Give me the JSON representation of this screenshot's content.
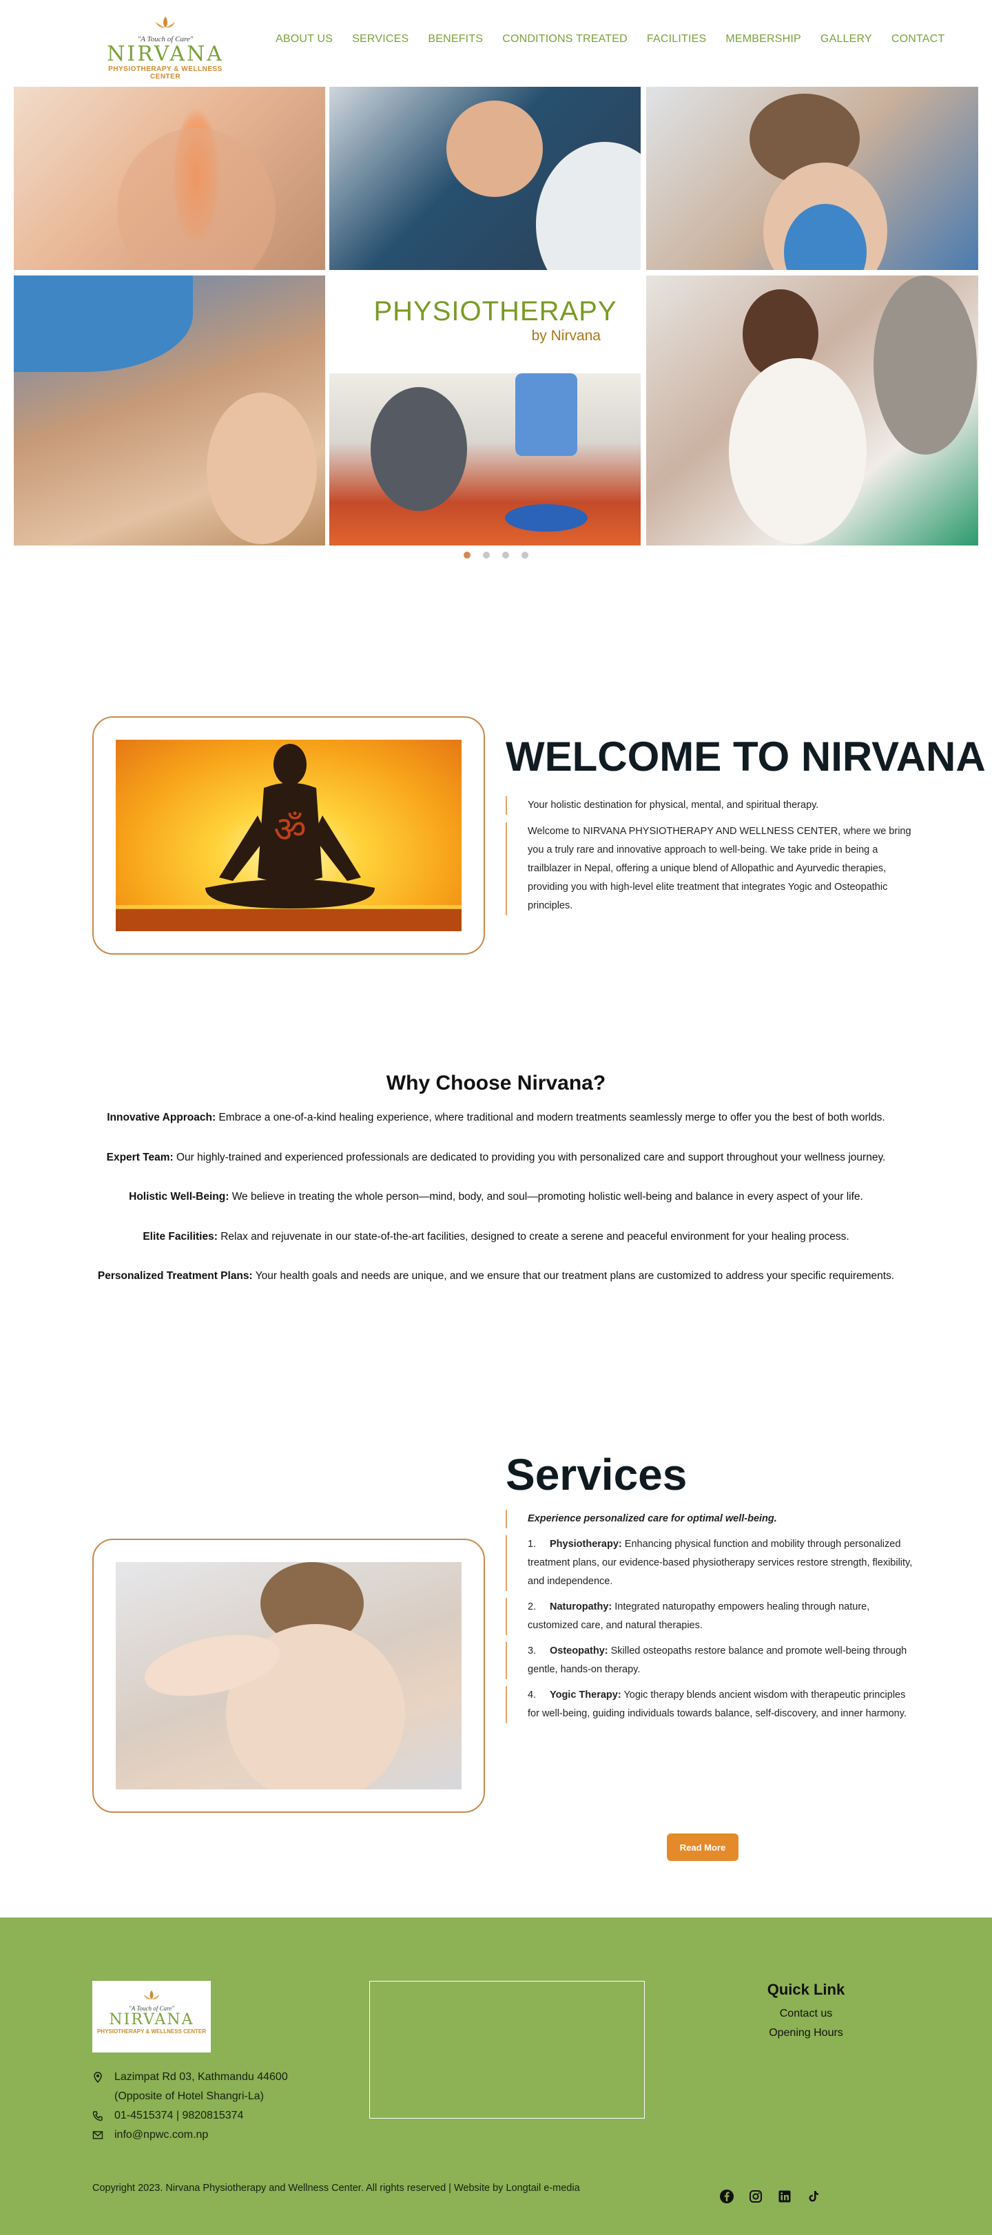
{
  "header": {
    "logo_tagline": "\"A Touch of Care\"",
    "logo_name": "NIRVANA",
    "logo_subtitle": "PHYSIOTHERAPY & WELLNESS CENTER",
    "nav": [
      "ABOUT US",
      "SERVICES",
      "BENEFITS",
      "CONDITIONS TREATED",
      "FACILITIES",
      "MEMBERSHIP",
      "GALLERY",
      "CONTACT"
    ]
  },
  "hero": {
    "title": "PHYSIOTHERAPY",
    "subtitle": "by Nirvana",
    "slide_count": 4,
    "active_slide": 1
  },
  "welcome": {
    "title": "WELCOME TO NIRVANA",
    "lead": "Your holistic destination for physical, mental, and spiritual therapy.",
    "body": "Welcome to NIRVANA PHYSIOTHERAPY AND WELLNESS CENTER, where we bring you a truly rare and innovative approach to well-being. We take pride in being a trailblazer in Nepal, offering a unique blend of Allopathic and Ayurvedic therapies, providing you with high-level elite treatment that integrates Yogic and Osteopathic principles."
  },
  "why": {
    "title": "Why Choose Nirvana?",
    "items": [
      {
        "label": "Innovative Approach:",
        "text": " Embrace a one-of-a-kind healing experience, where traditional and modern treatments seamlessly merge to offer you the best of both worlds."
      },
      {
        "label": "Expert Team:",
        "text": " Our highly-trained and experienced professionals are dedicated to providing you with personalized care and support throughout your wellness journey."
      },
      {
        "label": "Holistic Well-Being:",
        "text": " We believe in treating the whole person—mind, body, and soul—promoting holistic well-being and balance in every aspect of your life."
      },
      {
        "label": "Elite Facilities:",
        "text": " Relax and rejuvenate in our state-of-the-art facilities, designed to create a serene and peaceful environment for your healing process."
      },
      {
        "label": "Personalized Treatment Plans:",
        "text": " Your health goals and needs are unique, and we ensure that our treatment plans are customized to address your specific requirements."
      }
    ]
  },
  "services": {
    "title": "Services",
    "tagline": "Experience personalized care for optimal well-being.",
    "items": [
      {
        "num": "1.",
        "label": "Physiotherapy:",
        "text": " Enhancing physical function and mobility through personalized treatment plans, our evidence-based physiotherapy services restore strength, flexibility, and independence."
      },
      {
        "num": "2.",
        "label": "Naturopathy:",
        "text": " Integrated naturopathy empowers healing through nature, customized care, and natural therapies."
      },
      {
        "num": "3.",
        "label": "Osteopathy:",
        "text": " Skilled osteopaths restore balance and promote well-being through gentle, hands-on therapy."
      },
      {
        "num": "4.",
        "label": "Yogic Therapy:",
        "text": " Yogic therapy blends ancient wisdom with therapeutic principles for well-being, guiding individuals towards balance, self-discovery, and inner harmony."
      }
    ],
    "read_more": "Read More"
  },
  "footer": {
    "address_line1": "Lazimpat Rd 03, Kathmandu 44600",
    "address_line2": "(Opposite of Hotel Shangri-La)",
    "phone": "01-4515374 | 9820815374",
    "email": "info@npwc.com.np",
    "quick_link_title": "Quick Link",
    "quick_links": [
      "Contact us",
      "Opening Hours"
    ],
    "copyright": "Copyright 2023. Nirvana Physiotherapy and Wellness Center. All rights reserved | Website by Longtail e-media",
    "social": [
      "facebook-icon",
      "instagram-icon",
      "linkedin-icon",
      "tiktok-icon"
    ]
  },
  "colors": {
    "brand_green": "#7aa23a",
    "accent_orange": "#e58a2a",
    "frame_brown": "#c88a4c",
    "footer_green": "#8db155"
  }
}
